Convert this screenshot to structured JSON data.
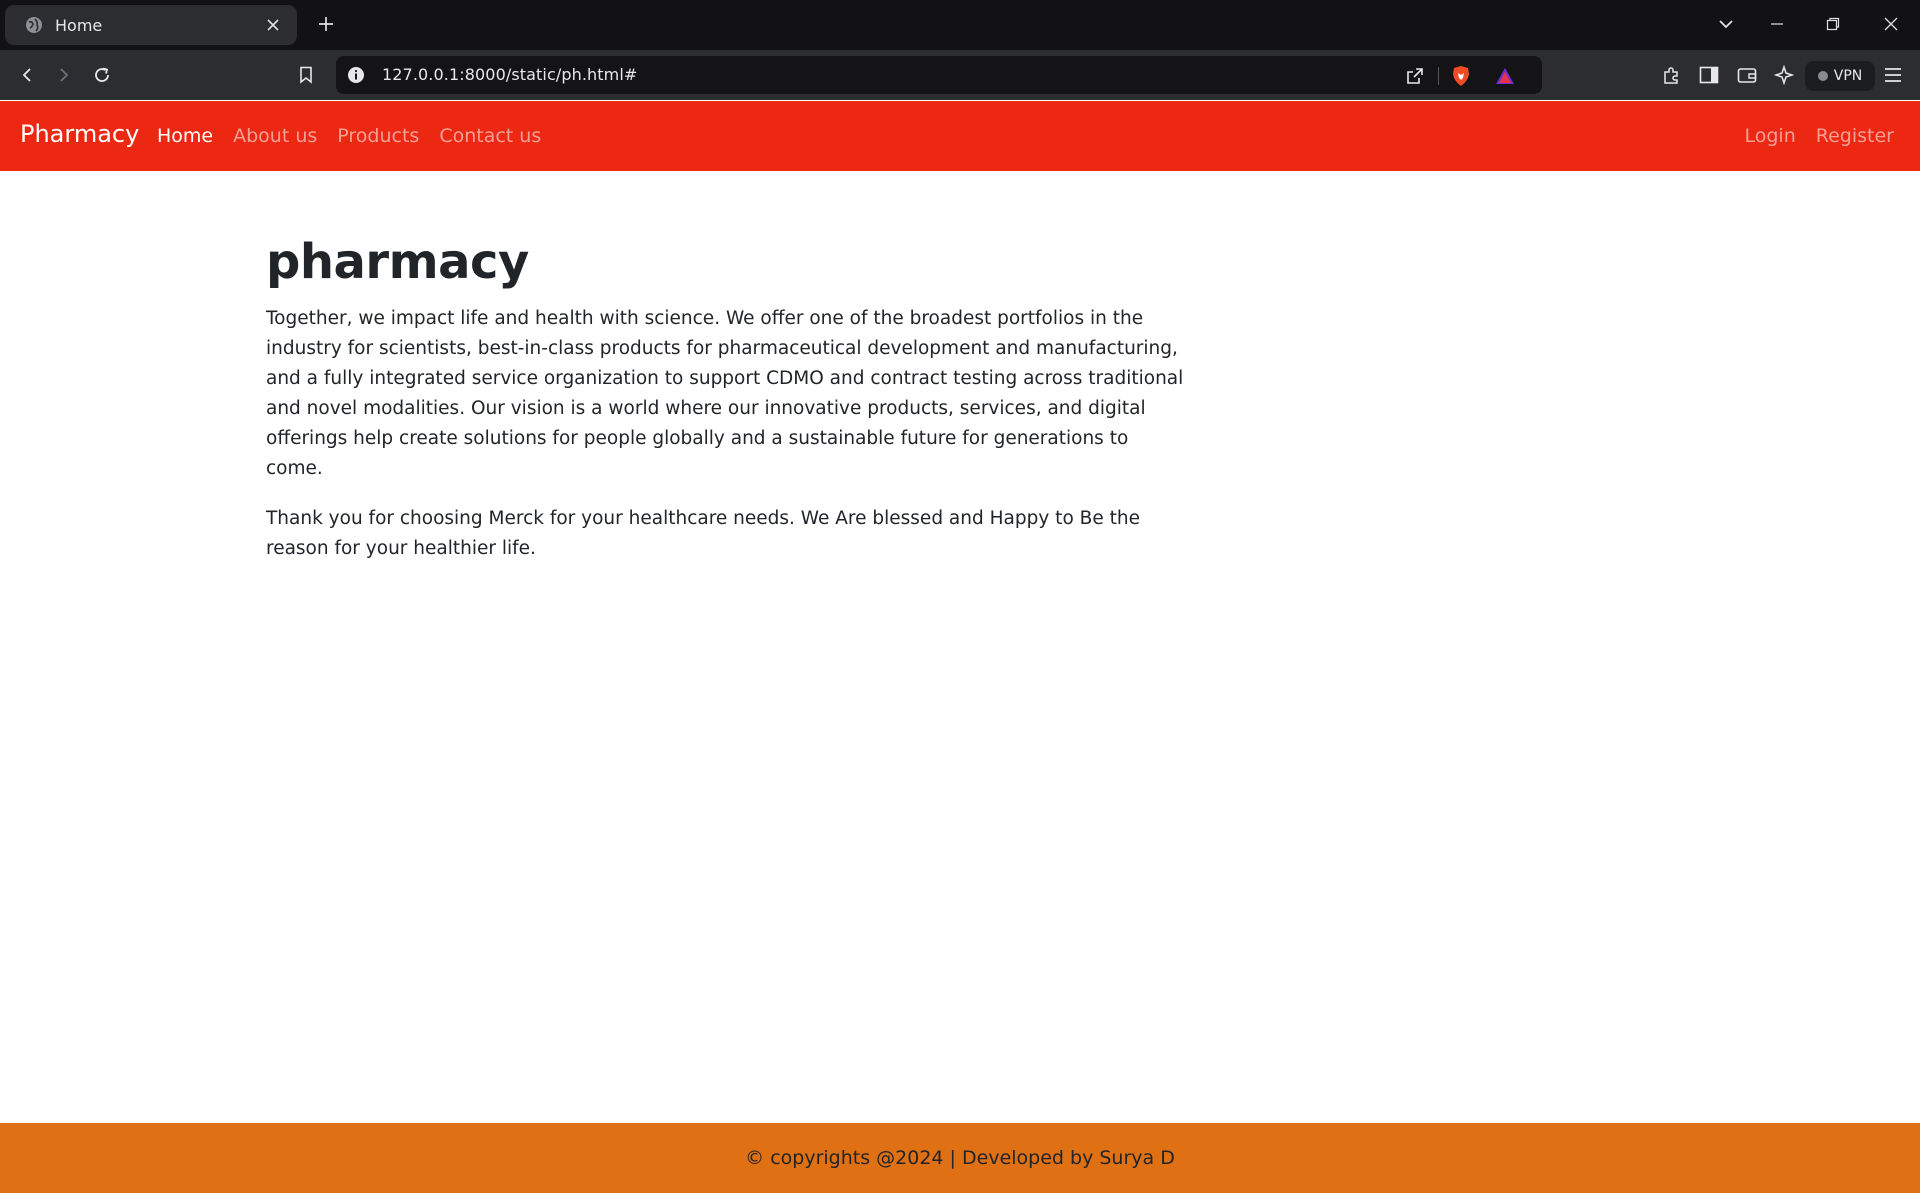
{
  "browser": {
    "tab_title": "Home",
    "url": "127.0.0.1:8000/static/ph.html#",
    "vpn_label": "VPN"
  },
  "navbar": {
    "brand": "Pharmacy",
    "links": [
      "Home",
      "About us",
      "Products",
      "Contact us"
    ],
    "active_link": "Home",
    "auth": {
      "login": "Login",
      "register": "Register"
    },
    "color": "#ec2712"
  },
  "main": {
    "heading": "pharmacy",
    "paragraphs": [
      "Together, we impact life and health with science. We offer one of the broadest portfolios in the industry for scientists, best-in-class products for pharmaceutical development and manufacturing, and a fully integrated service organization to support CDMO and contract testing across traditional and novel modalities. Our vision is a world where our innovative products, services, and digital offerings help create solutions for people globally and a sustainable future for generations to come.",
      "Thank you for choosing Merck for your healthcare needs. We Are blessed and Happy to Be the reason for your healthier life."
    ]
  },
  "footer": {
    "text": "© copyrights @2024 | Developed by Surya D",
    "color": "#e07014"
  }
}
